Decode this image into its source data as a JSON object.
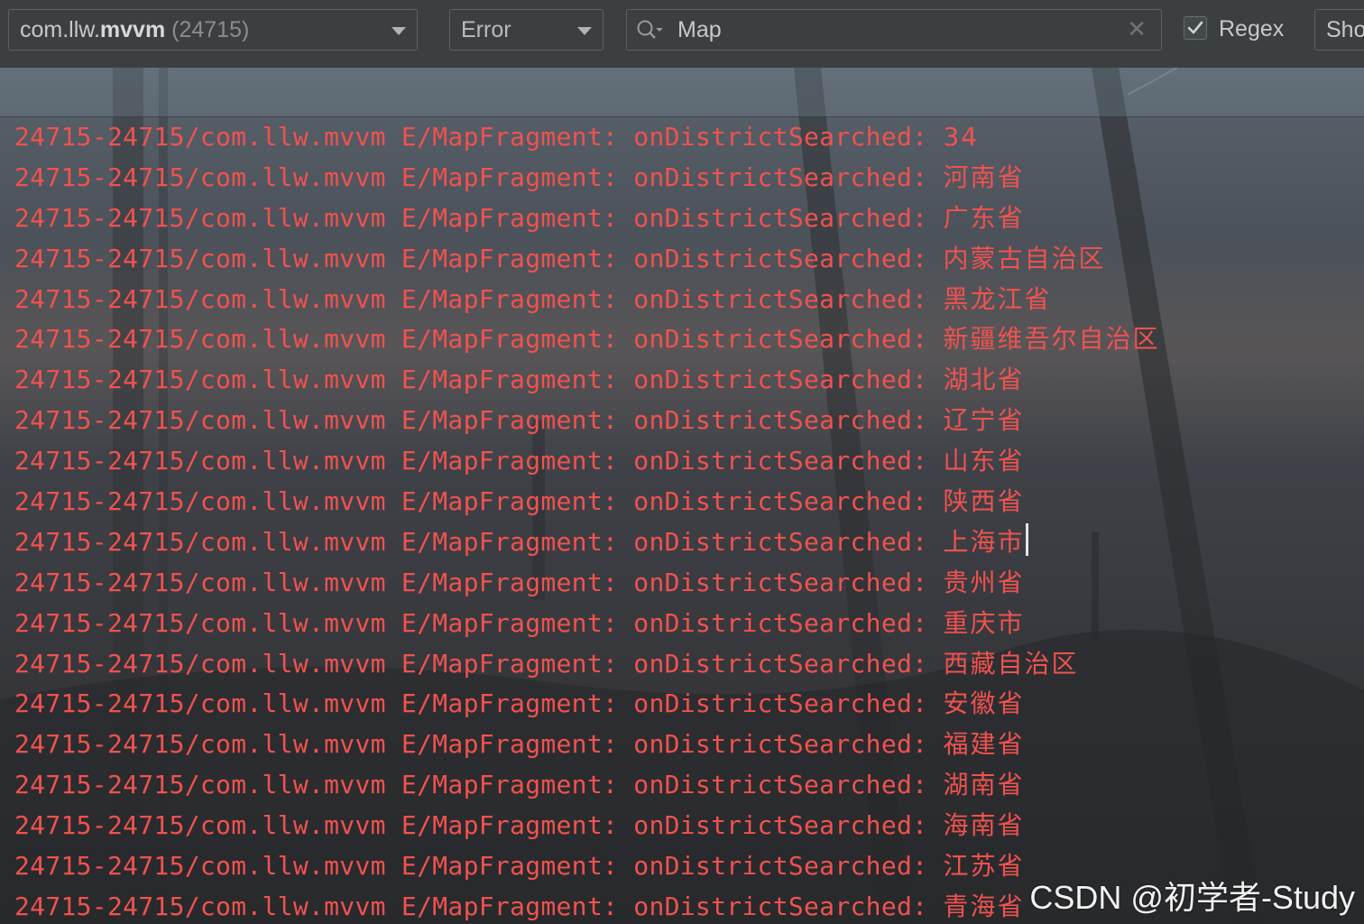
{
  "toolbar": {
    "process_combo": {
      "package_prefix": "com.llw.",
      "package_name": "mvvm",
      "pid": "(24715)"
    },
    "level_combo": {
      "value": "Error"
    },
    "search": {
      "value": "Map"
    },
    "regex": {
      "label": "Regex",
      "checked": true
    },
    "show_button": {
      "label": "Sho"
    }
  },
  "log": {
    "prefix": "24715-24715/com.llw.mvvm E/MapFragment: onDistrictSearched: ",
    "lines": [
      {
        "message": "34"
      },
      {
        "message": "河南省"
      },
      {
        "message": "广东省"
      },
      {
        "message": "内蒙古自治区"
      },
      {
        "message": "黑龙江省"
      },
      {
        "message": "新疆维吾尔自治区"
      },
      {
        "message": "湖北省"
      },
      {
        "message": "辽宁省"
      },
      {
        "message": "山东省"
      },
      {
        "message": "陕西省"
      },
      {
        "message": "上海市",
        "caret": true
      },
      {
        "message": "贵州省"
      },
      {
        "message": "重庆市"
      },
      {
        "message": "西藏自治区"
      },
      {
        "message": "安徽省"
      },
      {
        "message": "福建省"
      },
      {
        "message": "湖南省"
      },
      {
        "message": "海南省"
      },
      {
        "message": "江苏省"
      },
      {
        "message": "青海省"
      }
    ]
  },
  "watermark": {
    "text": "CSDN @初学者-Study"
  },
  "colors": {
    "log_error": "#f0524f",
    "toolbar_bg": "#3c3f41",
    "control_border": "#5e6163",
    "text_primary": "#c8c8c8"
  }
}
